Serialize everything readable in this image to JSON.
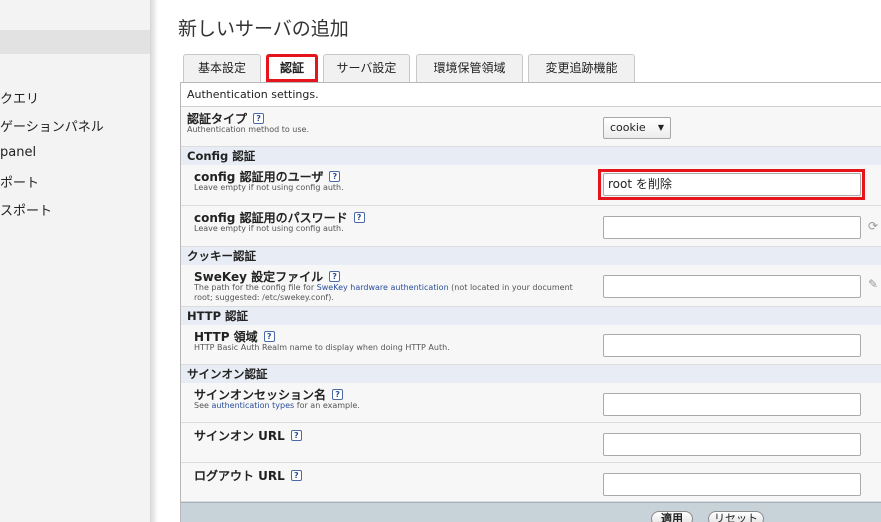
{
  "sidebar": {
    "items": [
      {
        "label": "クエリ"
      },
      {
        "label": "ゲーションパネル"
      },
      {
        "label": "panel"
      },
      {
        "label": "ポート"
      },
      {
        "label": "スポート"
      }
    ]
  },
  "page": {
    "title": "新しいサーバの追加"
  },
  "tabs": [
    {
      "label": "基本設定"
    },
    {
      "label": "認証"
    },
    {
      "label": "サーバ設定"
    },
    {
      "label": "環境保管領域"
    },
    {
      "label": "変更追跡機能"
    }
  ],
  "auth": {
    "description": "Authentication settings.",
    "auth_type": {
      "label": "認証タイプ",
      "help": "Authentication method to use.",
      "value": "cookie"
    },
    "config_group": {
      "title": "Config 認証",
      "user": {
        "label": "config 認証用のユーザ",
        "help": "Leave empty if not using config auth.",
        "value": "root を削除"
      },
      "password": {
        "label": "config 認証用のパスワード",
        "help": "Leave empty if not using config auth.",
        "value": ""
      }
    },
    "cookie_group": {
      "title": "クッキー認証",
      "swekey": {
        "label": "SweKey 設定ファイル",
        "help_pre": "The path for the config file for ",
        "help_link": "SweKey hardware authentication",
        "help_post": " (not located in your document",
        "help_line2": "root; suggested: /etc/swekey.conf).",
        "value": ""
      }
    },
    "http_group": {
      "title": "HTTP 認証",
      "realm": {
        "label": "HTTP 領域",
        "help": "HTTP Basic Auth Realm name to display when doing HTTP Auth.",
        "value": ""
      }
    },
    "signon_group": {
      "title": "サインオン認証",
      "session": {
        "label": "サインオンセッション名",
        "help_pre": "See ",
        "help_link": "authentication types",
        "help_post": " for an example.",
        "value": ""
      },
      "url": {
        "label": "サインオン URL",
        "value": ""
      },
      "logout": {
        "label": "ログアウト URL",
        "value": ""
      }
    }
  },
  "footer": {
    "apply": "適用",
    "reset": "リセット"
  },
  "icons": {
    "help": "?",
    "refresh": "⟳",
    "edit": "✎",
    "dropdown": "▼"
  },
  "colors": {
    "highlight_red": "#e6151c",
    "link_blue": "#2a4f9c",
    "group_header": "#e8ecf4"
  }
}
